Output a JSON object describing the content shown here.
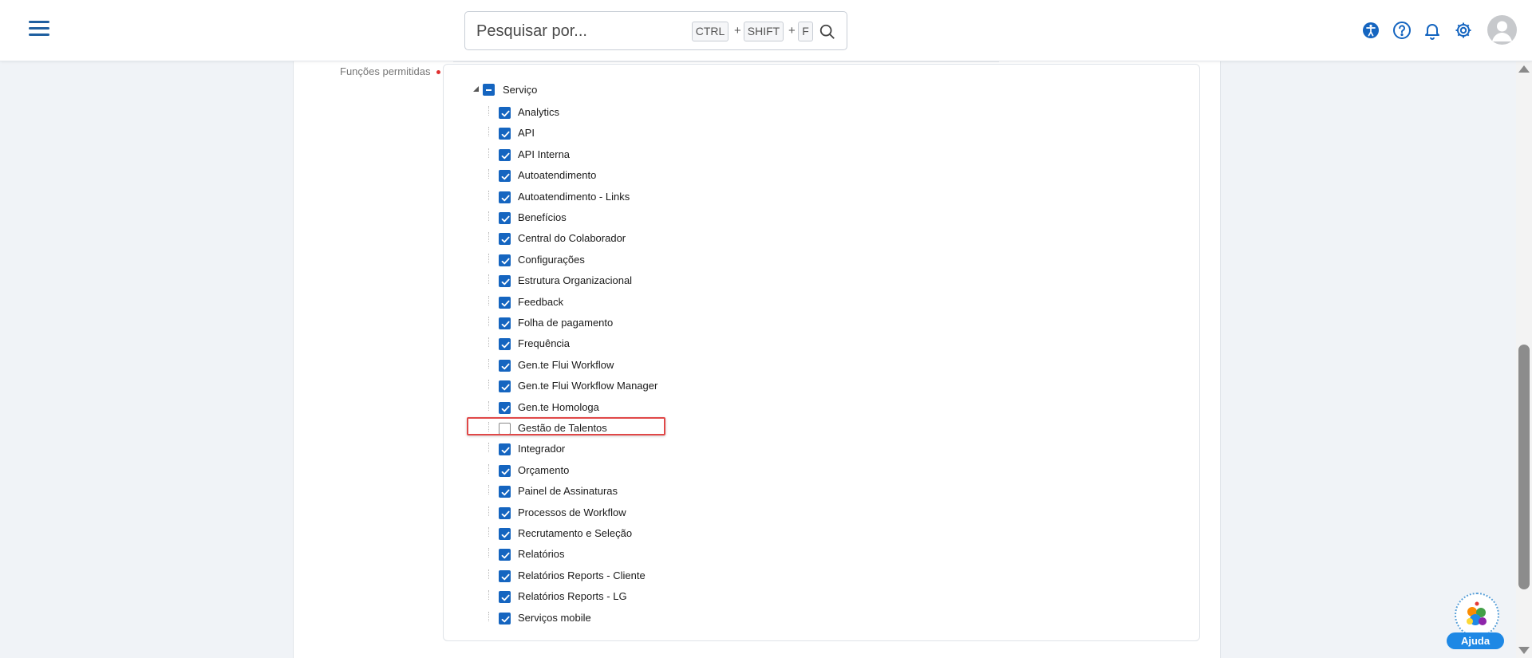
{
  "header": {
    "search_placeholder": "Pesquisar por...",
    "shortcut_keys": [
      "CTRL",
      "SHIFT",
      "F"
    ],
    "shortcut_plus": "+",
    "accent_color": "#1565c0"
  },
  "form": {
    "field_label": "Funções permitidas"
  },
  "tree": {
    "root": {
      "label": "Serviço",
      "state": "partial"
    },
    "children": [
      {
        "label": "Analytics",
        "checked": true
      },
      {
        "label": "API",
        "checked": true
      },
      {
        "label": "API Interna",
        "checked": true
      },
      {
        "label": "Autoatendimento",
        "checked": true
      },
      {
        "label": "Autoatendimento - Links",
        "checked": true
      },
      {
        "label": "Benefícios",
        "checked": true
      },
      {
        "label": "Central do Colaborador",
        "checked": true
      },
      {
        "label": "Configurações",
        "checked": true
      },
      {
        "label": "Estrutura Organizacional",
        "checked": true
      },
      {
        "label": "Feedback",
        "checked": true
      },
      {
        "label": "Folha de pagamento",
        "checked": true
      },
      {
        "label": "Frequência",
        "checked": true
      },
      {
        "label": "Gen.te Flui Workflow",
        "checked": true
      },
      {
        "label": "Gen.te Flui Workflow Manager",
        "checked": true
      },
      {
        "label": "Gen.te Homologa",
        "checked": true
      },
      {
        "label": "Gestão de Talentos",
        "checked": false
      },
      {
        "label": "Integrador",
        "checked": true
      },
      {
        "label": "Orçamento",
        "checked": true
      },
      {
        "label": "Painel de Assinaturas",
        "checked": true
      },
      {
        "label": "Processos de Workflow",
        "checked": true
      },
      {
        "label": "Recrutamento e Seleção",
        "checked": true
      },
      {
        "label": "Relatórios",
        "checked": true
      },
      {
        "label": "Relatórios Reports - Cliente",
        "checked": true
      },
      {
        "label": "Relatórios Reports - LG",
        "checked": true
      },
      {
        "label": "Serviços mobile",
        "checked": true
      }
    ]
  },
  "help_widget": {
    "label": "Ajuda"
  }
}
